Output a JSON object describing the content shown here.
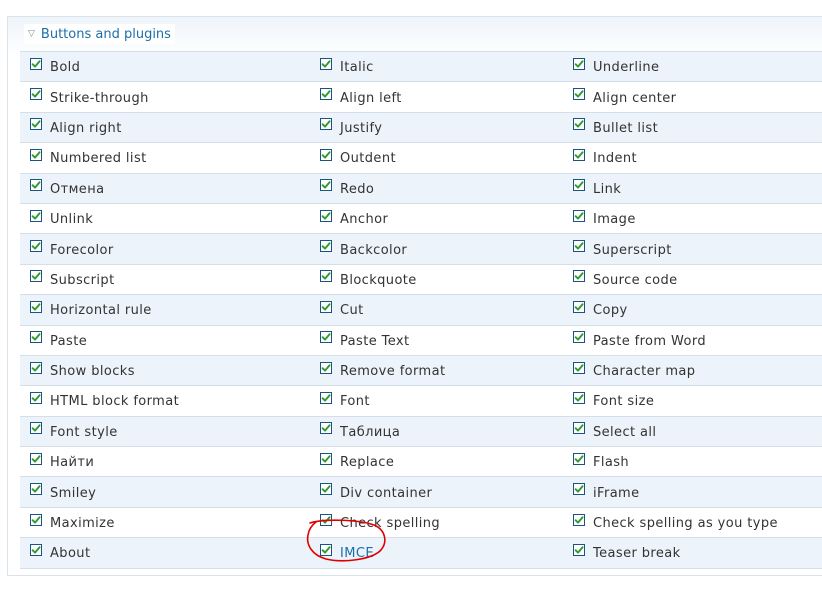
{
  "fieldset": {
    "legend": "Buttons and plugins"
  },
  "rows": [
    [
      "Bold",
      "Italic",
      "Underline"
    ],
    [
      "Strike-through",
      "Align left",
      "Align center"
    ],
    [
      "Align right",
      "Justify",
      "Bullet list"
    ],
    [
      "Numbered list",
      "Outdent",
      "Indent"
    ],
    [
      "Отмена",
      "Redo",
      "Link"
    ],
    [
      "Unlink",
      "Anchor",
      "Image"
    ],
    [
      "Forecolor",
      "Backcolor",
      "Superscript"
    ],
    [
      "Subscript",
      "Blockquote",
      "Source code"
    ],
    [
      "Horizontal rule",
      "Cut",
      "Copy"
    ],
    [
      "Paste",
      "Paste Text",
      "Paste from Word"
    ],
    [
      "Show blocks",
      "Remove format",
      "Character map"
    ],
    [
      "HTML block format",
      "Font",
      "Font size"
    ],
    [
      "Font style",
      "Таблица",
      "Select all"
    ],
    [
      "Найти",
      "Replace",
      "Flash"
    ],
    [
      "Smiley",
      "Div container",
      "iFrame"
    ],
    [
      "Maximize",
      "Check spelling",
      "Check spelling as you type"
    ],
    [
      "About",
      "IMCE",
      "Teaser break"
    ]
  ],
  "checked": true,
  "link_item": "IMCE",
  "colors": {
    "link": "#1b6fa8",
    "check": "#2e9a2e",
    "annotation": "#e00000"
  }
}
